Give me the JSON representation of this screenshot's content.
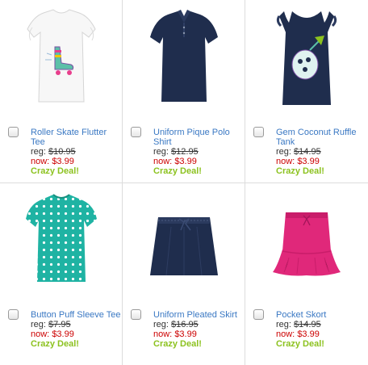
{
  "products": [
    {
      "name": "Roller Skate Flutter Tee",
      "reg_label": "reg:",
      "reg_price": "$10.95",
      "now_label": "now:",
      "now_price": "$3.99",
      "badge": "Crazy Deal!"
    },
    {
      "name": "Uniform Pique Polo Shirt",
      "reg_label": "reg:",
      "reg_price": "$12.95",
      "now_label": "now:",
      "now_price": "$3.99",
      "badge": "Crazy Deal!"
    },
    {
      "name": "Gem Coconut Ruffle Tank",
      "reg_label": "reg:",
      "reg_price": "$14.95",
      "now_label": "now:",
      "now_price": "$3.99",
      "badge": "Crazy Deal!"
    },
    {
      "name": "Button Puff Sleeve Tee",
      "reg_label": "reg:",
      "reg_price": "$7.95",
      "now_label": "now:",
      "now_price": "$3.99",
      "badge": "Crazy Deal!"
    },
    {
      "name": "Uniform Pleated Skirt",
      "reg_label": "reg:",
      "reg_price": "$16.95",
      "now_label": "now:",
      "now_price": "$3.99",
      "badge": "Crazy Deal!"
    },
    {
      "name": "Pocket Skort",
      "reg_label": "reg:",
      "reg_price": "$14.95",
      "now_label": "now:",
      "now_price": "$3.99",
      "badge": "Crazy Deal!"
    }
  ],
  "colors": {
    "link": "#3a78c3",
    "sale_price": "#cc0000",
    "deal_badge": "#8cc21f",
    "navy_garment": "#1f2d4d",
    "teal_garment": "#1fb3a3",
    "pink_garment": "#e0287a"
  }
}
